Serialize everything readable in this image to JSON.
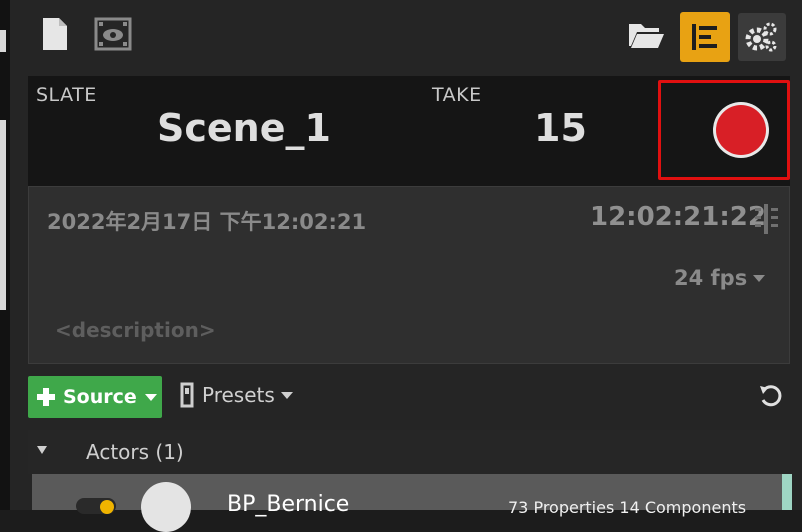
{
  "toolbar": {
    "new_icon": "document-icon",
    "review_icon": "film-eye-icon",
    "open_icon": "folder-open-icon",
    "timecode_icon": "list-timecode-icon",
    "settings_icon": "gears-icon",
    "accent_color": "#e8a213"
  },
  "slate": {
    "label": "SLATE",
    "value": "Scene_1"
  },
  "take": {
    "label": "TAKE",
    "value": "15"
  },
  "record": {
    "color": "#e02020"
  },
  "timestamp": "2022年2月17日 下午12:02:21",
  "timecode": "12:02:21:22",
  "fps": "24 fps",
  "description_placeholder": "<description>",
  "sources": {
    "add_label": "Source",
    "presets_label": "Presets",
    "add_color": "#3fa84a"
  },
  "actors": {
    "header": "Actors (1)",
    "row_name": "BP_Bernice",
    "row_info": "73 Properties 14 Components"
  }
}
